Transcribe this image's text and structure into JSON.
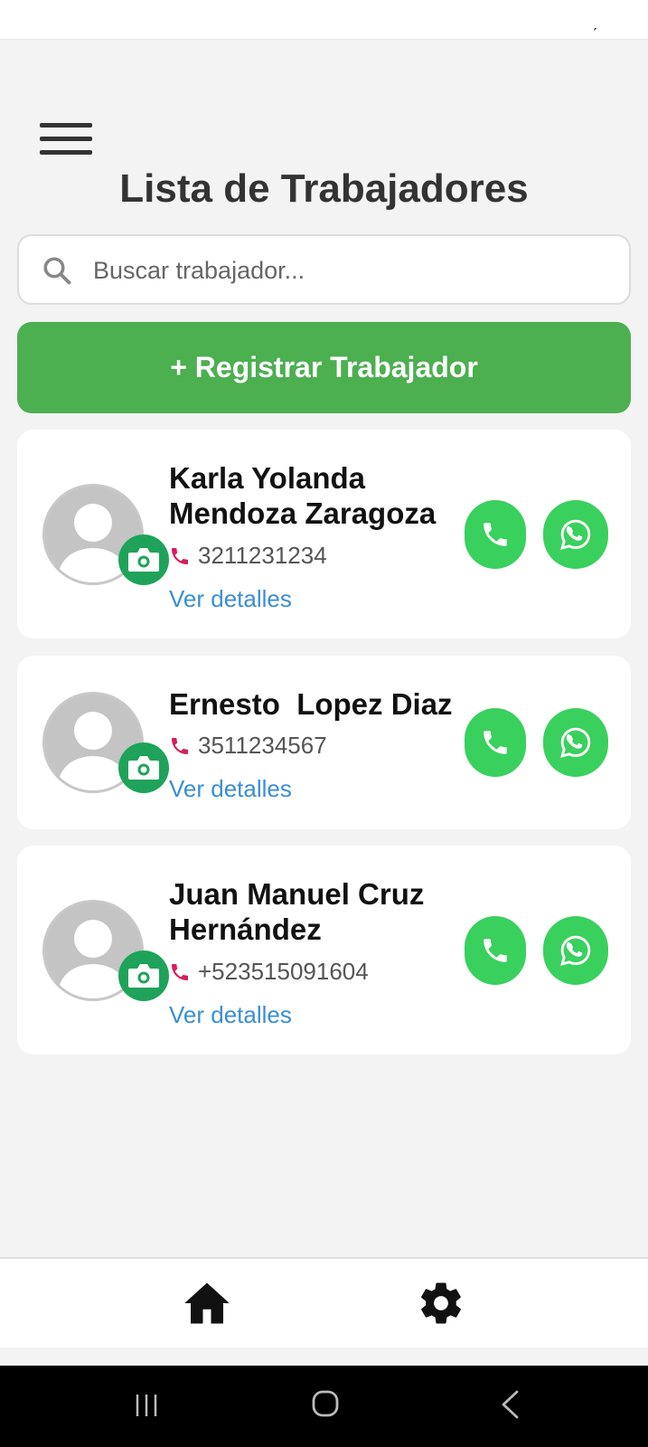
{
  "status_bar": {
    "mark": "ˏ"
  },
  "header": {
    "title": "Lista de Trabajadores"
  },
  "search": {
    "placeholder": "Buscar trabajador...",
    "value": ""
  },
  "actions": {
    "register_label": "+ Registrar Trabajador"
  },
  "workers": [
    {
      "name": "Karla Yolanda Mendoza Zaragoza",
      "phone": "3211231234",
      "details_label": "Ver detalles"
    },
    {
      "name": "Ernesto  Lopez Diaz",
      "phone": "3511234567",
      "details_label": "Ver detalles"
    },
    {
      "name": "Juan Manuel Cruz Hernández",
      "phone": "+523515091604",
      "details_label": "Ver detalles"
    }
  ],
  "bottom_nav": {
    "items": [
      "home-icon",
      "gear-icon"
    ]
  },
  "system_nav": {
    "items": [
      "recent-apps-icon",
      "home-circle-icon",
      "back-icon"
    ]
  },
  "colors": {
    "primary_green": "#4caf50",
    "action_green": "#3ad05e",
    "camera_badge": "#1fa35a",
    "link_blue": "#3a8ed4",
    "phone_icon": "#d81b60",
    "title_text": "#333333"
  }
}
